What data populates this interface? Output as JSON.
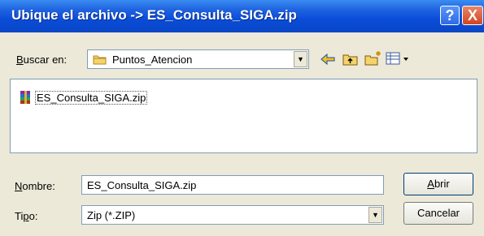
{
  "dialog": {
    "title": "Ubique el archivo -> ES_Consulta_SIGA.zip",
    "help_glyph": "?",
    "close_glyph": "X"
  },
  "lookin": {
    "label_u": "B",
    "label_rest": "uscar en:",
    "value": "Puntos_Atencion",
    "folder_icon": "folder-icon"
  },
  "toolbar": {
    "back_icon": "back-arrow-icon",
    "up_icon": "up-folder-icon",
    "new_icon": "new-folder-icon",
    "view_icon": "view-menu-icon"
  },
  "files": [
    {
      "name": "ES_Consulta_SIGA.zip",
      "icon": "winrar-archive-icon"
    }
  ],
  "filename": {
    "label_u": "N",
    "label_rest": "ombre:",
    "value": "ES_Consulta_SIGA.zip"
  },
  "filetype": {
    "label_a": "Ti",
    "label_u": "p",
    "label_b": "o:",
    "value": "Zip (*.ZIP)"
  },
  "buttons": {
    "open_u": "A",
    "open_rest": "brir",
    "cancel": "Cancelar"
  },
  "colors": {
    "titlebar": "#0a4cd8",
    "face": "#ece9d8"
  }
}
